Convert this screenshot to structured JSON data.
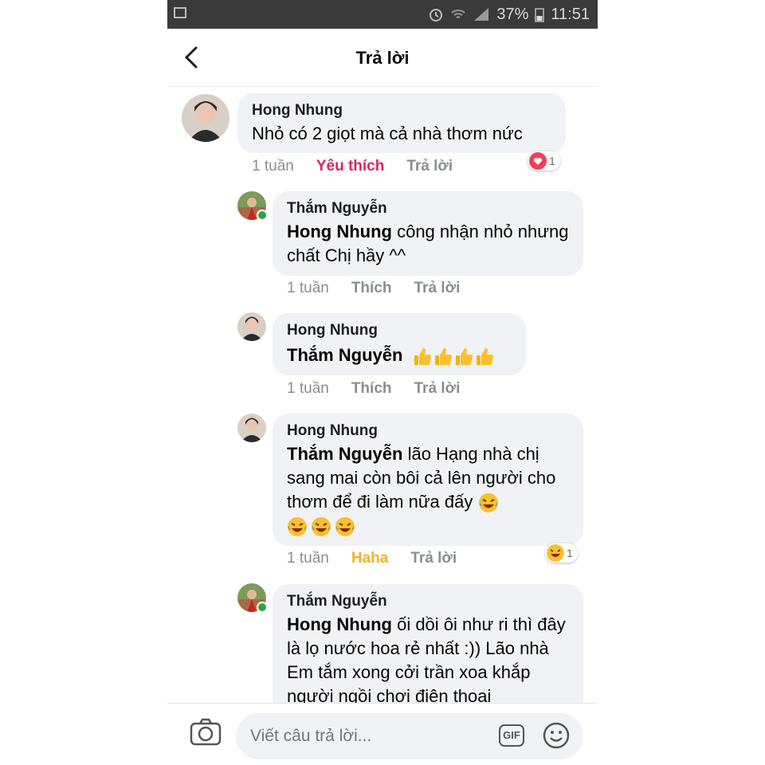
{
  "status_bar": {
    "battery": "37%",
    "time": "11:51"
  },
  "header": {
    "title": "Trả lời",
    "back_icon": "chevron-left-icon"
  },
  "comments": [
    {
      "author": "Hong Nhung",
      "text": "Nhỏ có 2 giọt mà cả nhà thơm nức",
      "time": "1 tuần",
      "like": "Yêu thích",
      "reply": "Trả lời",
      "reaction": {
        "icon": "heart-icon",
        "count": "1"
      }
    },
    {
      "author": "Thắm Nguyễn",
      "mention": "Hong Nhung",
      "text": " công nhận nhỏ nhưng chất Chị hầy ^^",
      "time": "1 tuần",
      "like": "Thích",
      "reply": "Trả lời"
    },
    {
      "author": "Hong Nhung",
      "mention": "Thắm Nguyễn",
      "emojis": "thumbs-up-icon x4",
      "time": "1 tuần",
      "like": "Thích",
      "reply": "Trả lời"
    },
    {
      "author": "Hong Nhung",
      "mention": "Thắm Nguyễn",
      "text": " lão Hạng nhà chị sang mai còn bôi cả lên người cho thơm để đi làm nữa đấy",
      "emojis": "tears-of-joy-icon x4",
      "time": "1 tuần",
      "like": "Haha",
      "reply": "Trả lời",
      "reaction": {
        "icon": "haha-icon",
        "count": "1"
      }
    },
    {
      "author": "Thắm Nguyễn",
      "mention": "Hong Nhung",
      "text": " ối dồi ôi như ri thì đây là lọ nước hoa rẻ nhất :)) Lão nhà Em tắm xong cởi trần xoa khắp người ngồi chơi điện thoại"
    }
  ],
  "composer": {
    "placeholder": "Viết câu trả lời...",
    "gif_label": "GIF",
    "camera_icon": "camera-icon",
    "emoji_icon": "smiley-icon"
  },
  "colors": {
    "love": "#e0245e",
    "haha": "#f7b125",
    "bubble": "#f0f2f5",
    "online": "#31a24c"
  }
}
